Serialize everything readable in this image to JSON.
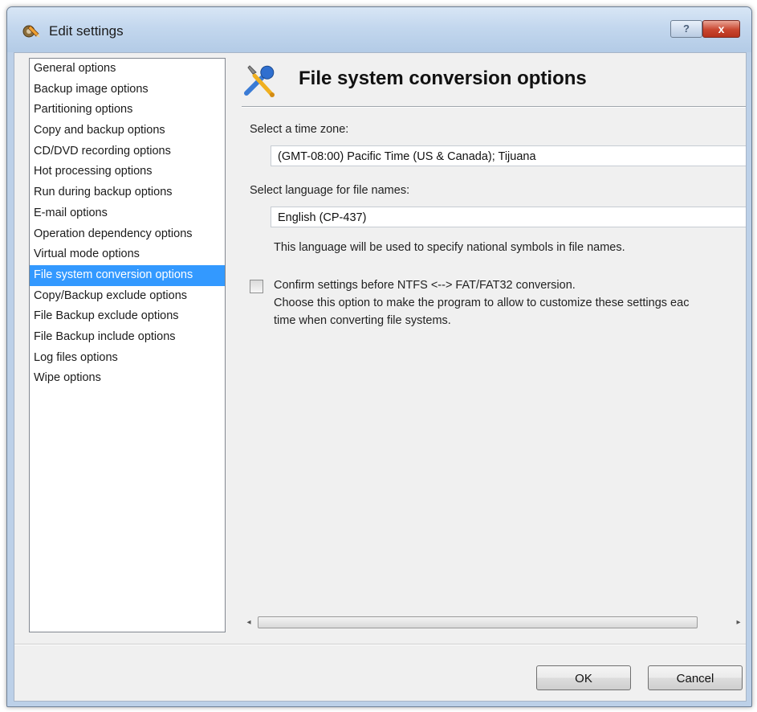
{
  "window": {
    "title": "Edit settings",
    "help_label": "?",
    "close_label": "x"
  },
  "nav": {
    "items": [
      {
        "label": "General options"
      },
      {
        "label": "Backup image options"
      },
      {
        "label": "Partitioning options"
      },
      {
        "label": "Copy and backup options"
      },
      {
        "label": "CD/DVD recording options"
      },
      {
        "label": "Hot processing options"
      },
      {
        "label": "Run during backup options"
      },
      {
        "label": "E-mail options"
      },
      {
        "label": "Operation dependency options"
      },
      {
        "label": "Virtual mode options"
      },
      {
        "label": "File system conversion options",
        "selected": true
      },
      {
        "label": "Copy/Backup exclude options"
      },
      {
        "label": "File Backup exclude options"
      },
      {
        "label": "File Backup include options"
      },
      {
        "label": "Log files options"
      },
      {
        "label": "Wipe options"
      }
    ]
  },
  "panel": {
    "title": "File system conversion options",
    "timezone_label": "Select a time zone:",
    "timezone_value": "(GMT-08:00) Pacific Time (US & Canada); Tijuana",
    "language_label": "Select language for file names:",
    "language_value": "English (CP-437)",
    "language_hint": "This language will be used to specify national symbols in file names.",
    "confirm_label": "Confirm settings before NTFS <--> FAT/FAT32 conversion.",
    "confirm_checked": false,
    "confirm_desc_line1": "Choose this option to make the program to allow to customize these settings eac",
    "confirm_desc_line2": "time when converting file systems."
  },
  "scrollbar": {
    "left_arrow": "◂",
    "right_arrow": "▸"
  },
  "footer": {
    "ok_label": "OK",
    "cancel_label": "Cancel"
  },
  "icons": {
    "window_icon": "settings-pencil-icon",
    "panel_icon": "wrench-screwdriver-icon"
  },
  "colors": {
    "selection": "#3399ff",
    "titlebar": "#c3d7ee",
    "close_button": "#c9462f"
  }
}
